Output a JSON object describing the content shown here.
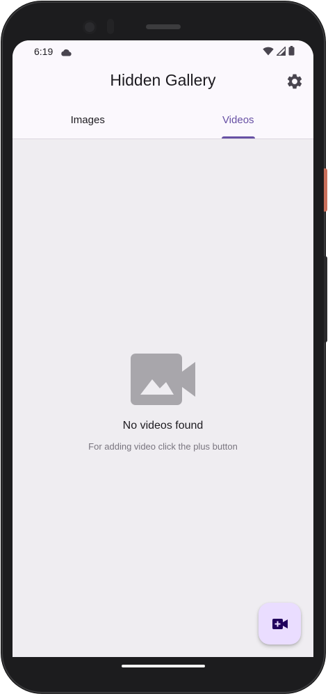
{
  "status_bar": {
    "time": "6:19",
    "icons": [
      "cloud-icon",
      "wifi-icon",
      "cellular-signal-icon",
      "battery-icon"
    ]
  },
  "app_bar": {
    "title": "Hidden Gallery",
    "settings_icon": "gear-icon"
  },
  "tabs": [
    {
      "label": "Images",
      "active": false
    },
    {
      "label": "Videos",
      "active": true
    }
  ],
  "empty_state": {
    "icon": "video-camera-icon",
    "title": "No videos found",
    "subtitle": "For adding video click the plus button"
  },
  "fab": {
    "icon": "add-video-icon"
  },
  "colors": {
    "accent": "#6750a4",
    "surface": "#fbf8fd",
    "background": "#efedf1",
    "fab": "#eaddff",
    "fab_icon": "#21005d",
    "empty_icon": "#a8a6ab"
  }
}
